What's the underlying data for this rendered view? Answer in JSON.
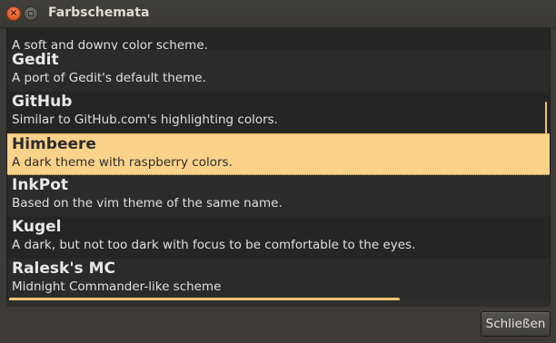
{
  "window": {
    "title": "Farbschemata",
    "close_glyph": "×",
    "minimize_glyph": ""
  },
  "schemes": [
    {
      "name": "",
      "description": "A soft and downy color scheme.",
      "selected": false
    },
    {
      "name": "Gedit",
      "description": "A port of Gedit's default theme.",
      "selected": false
    },
    {
      "name": "GitHub",
      "description": "Similar to GitHub.com's highlighting colors.",
      "selected": false
    },
    {
      "name": "Himbeere",
      "description": "A dark theme with raspberry colors.",
      "selected": true
    },
    {
      "name": "InkPot",
      "description": "Based on the vim theme of the same name.",
      "selected": false
    },
    {
      "name": "Kugel",
      "description": "A dark, but not too dark with focus to be comfortable to the eyes.",
      "selected": false
    },
    {
      "name": "Ralesk's MC",
      "description": "Midnight Commander-like scheme",
      "selected": false
    }
  ],
  "buttons": {
    "close_label": "Schließen"
  },
  "colors": {
    "selection": "#fbd28a",
    "accent": "#f2c47a",
    "close_button": "#e35e2b"
  }
}
